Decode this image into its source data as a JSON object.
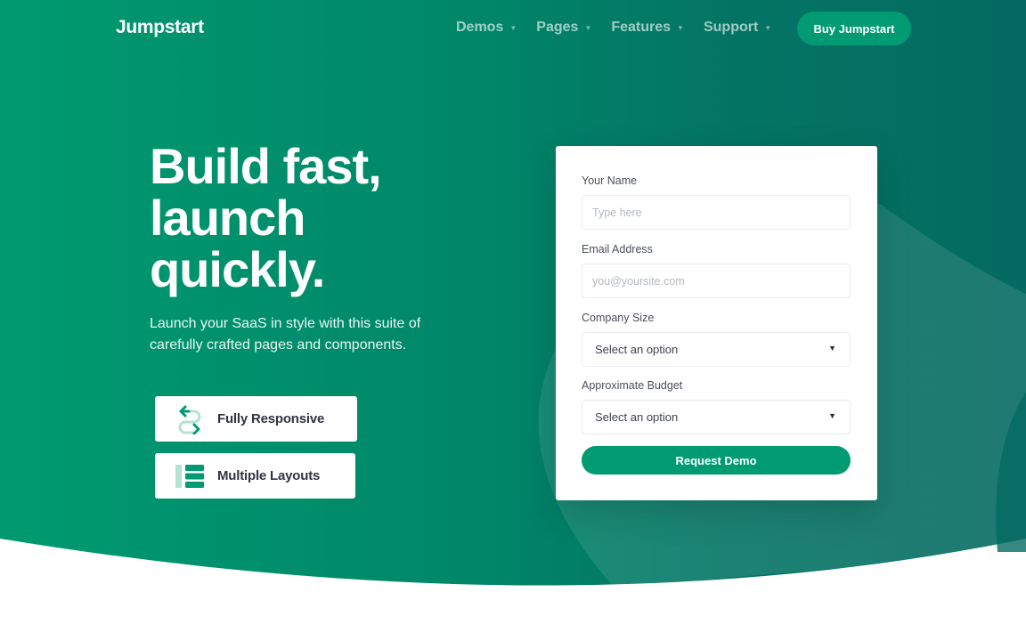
{
  "colors": {
    "brand_green": "#009b72",
    "hero_start": "#009a70",
    "hero_end": "#046a62",
    "card_bg": "#ffffff"
  },
  "nav": {
    "logo": "Jumpstart",
    "items": [
      {
        "label": "Demos",
        "icon": "caret-down-icon"
      },
      {
        "label": "Pages",
        "icon": "caret-down-icon"
      },
      {
        "label": "Features",
        "icon": "caret-down-icon"
      },
      {
        "label": "Support",
        "icon": "caret-down-icon"
      }
    ],
    "cta": "Buy Jumpstart"
  },
  "hero": {
    "headline_lines": [
      "Build fast,",
      "launch",
      "quickly."
    ],
    "subtitle_lines": [
      "Launch your SaaS in style with this suite of",
      "carefully crafted pages and components."
    ],
    "features": [
      {
        "label": "Fully Responsive",
        "icon": "arrows-swap-icon"
      },
      {
        "label": "Multiple Layouts",
        "icon": "layout-list-icon"
      }
    ]
  },
  "form": {
    "name": {
      "label": "Your Name",
      "placeholder": "Type here"
    },
    "email": {
      "label": "Email Address",
      "placeholder": "you@yoursite.com"
    },
    "company_size": {
      "label": "Company Size",
      "value": "Select an option"
    },
    "budget": {
      "label": "Approximate Budget",
      "value": "Select an option"
    },
    "submit": "Request Demo"
  }
}
